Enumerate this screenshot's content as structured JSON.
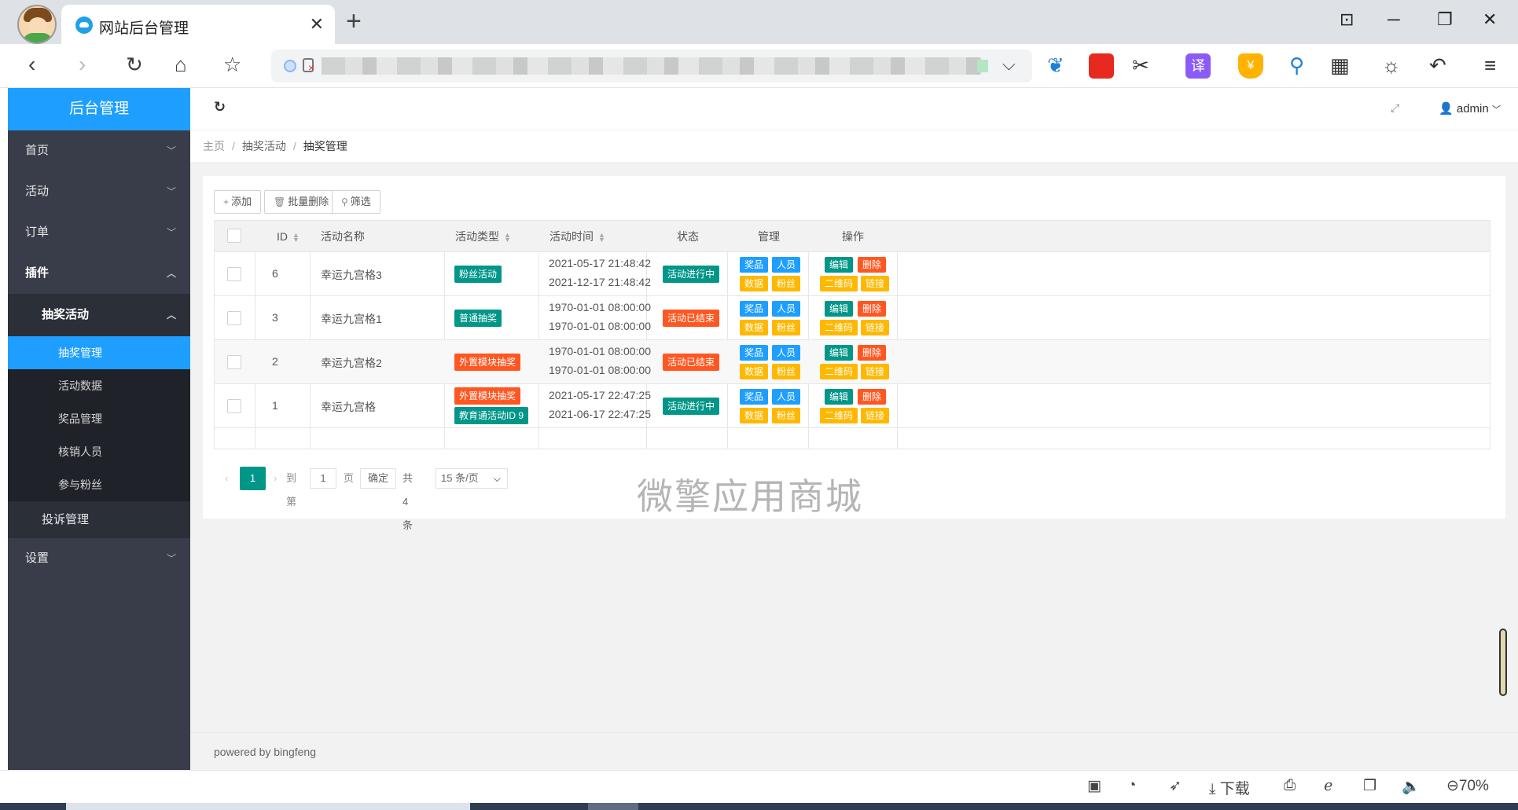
{
  "browser": {
    "tab_title": "网站后台管理",
    "tab_close": "✕",
    "new_tab": "+",
    "url_dropdown": "⌵",
    "window_controls": [
      "⊡",
      "─",
      "❐",
      "✕"
    ],
    "status_items": [
      "下载",
      "70%"
    ]
  },
  "sidebar": {
    "logo": "后台管理",
    "items": [
      {
        "label": "首页"
      },
      {
        "label": "活动"
      },
      {
        "label": "订单"
      },
      {
        "label": "插件"
      }
    ],
    "sub_group": "抽奖活动",
    "leaves": [
      {
        "label": "抽奖管理"
      },
      {
        "label": "活动数据"
      },
      {
        "label": "奖品管理"
      },
      {
        "label": "核销人员"
      },
      {
        "label": "参与粉丝"
      }
    ],
    "sub_other": "投诉管理",
    "settings": "设置"
  },
  "topbar": {
    "user": "admin"
  },
  "breadcrumb": [
    "主页",
    "抽奖活动",
    "抽奖管理"
  ],
  "toolbar": {
    "add": "添加",
    "batch_delete": "批量删除",
    "filter": "筛选"
  },
  "table": {
    "headers": {
      "id": "ID",
      "name": "活动名称",
      "type": "活动类型",
      "time": "活动时间",
      "status": "状态",
      "manage": "管理",
      "ops": "操作"
    },
    "manage_buttons": [
      "奖品",
      "人员",
      "数据",
      "粉丝"
    ],
    "op_buttons": [
      "编辑",
      "删除",
      "二维码",
      "链接"
    ],
    "rows": [
      {
        "id": "6",
        "name": "幸运九宫格3",
        "type1": "粉丝活动",
        "type2": "",
        "start": "2021-05-17 21:48:42",
        "end": "2021-12-17 21:48:42",
        "status": "活动进行中"
      },
      {
        "id": "3",
        "name": "幸运九宫格1",
        "type1": "普通抽奖",
        "type2": "",
        "start": "1970-01-01 08:00:00",
        "end": "1970-01-01 08:00:00",
        "status": "活动已结束"
      },
      {
        "id": "2",
        "name": "幸运九宫格2",
        "type1": "外置模块抽奖",
        "type2": "",
        "start": "1970-01-01 08:00:00",
        "end": "1970-01-01 08:00:00",
        "status": "活动已结束"
      },
      {
        "id": "1",
        "name": "幸运九宫格",
        "type1": "外置模块抽奖",
        "type2": "教育通活动ID 9",
        "start": "2021-05-17 22:47:25",
        "end": "2021-06-17 22:47:25",
        "status": "活动进行中"
      }
    ]
  },
  "pager": {
    "current": "1",
    "goto_label": "到第",
    "goto_value": "1",
    "page_unit": "页",
    "confirm": "确定",
    "total": "共 4 条",
    "per_page": "15 条/页"
  },
  "footer": "powered by bingfeng",
  "watermark": "微擎应用商城",
  "colors": {
    "primary": "#1e9fff",
    "green": "#009688",
    "orange": "#ff5722",
    "yellow": "#ffb800",
    "sidebar": "#393d49"
  }
}
